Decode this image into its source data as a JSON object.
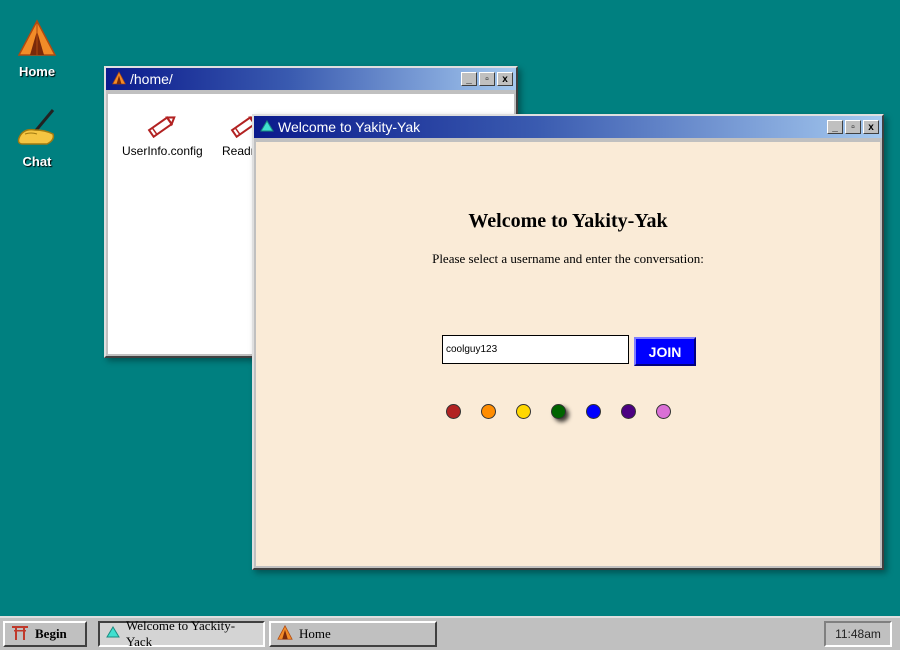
{
  "desktop": {
    "icons": [
      {
        "label": "Home",
        "icon": "tent-icon"
      },
      {
        "label": "Chat",
        "icon": "writing-hand-icon"
      }
    ]
  },
  "home_window": {
    "title": "/home/",
    "files": [
      {
        "name": "UserInfo.config",
        "icon": "pencil-icon"
      },
      {
        "name": "Readme",
        "icon": "pencil-icon"
      }
    ],
    "buttons": {
      "minimize": "_",
      "restore": "▫",
      "close": "x"
    }
  },
  "chat_window": {
    "title": "Welcome to Yakity-Yak",
    "heading": "Welcome to Yakity-Yak",
    "subheading": "Please select a username and enter the conversation:",
    "username_value": "coolguy123",
    "join_label": "JOIN",
    "colors": [
      "#b22222",
      "#ff8c00",
      "#ffd700",
      "#006400",
      "#0000ff",
      "#4b0082",
      "#da70d6"
    ],
    "selected_color_index": 3,
    "buttons": {
      "minimize": "_",
      "restore": "▫",
      "close": "x"
    }
  },
  "taskbar": {
    "start_label": "Begin",
    "tasks": [
      {
        "label": "Welcome to Yackity-Yack",
        "icon": "triangle-icon"
      },
      {
        "label": "Home",
        "icon": "tent-icon"
      }
    ],
    "clock": "11:48am"
  }
}
